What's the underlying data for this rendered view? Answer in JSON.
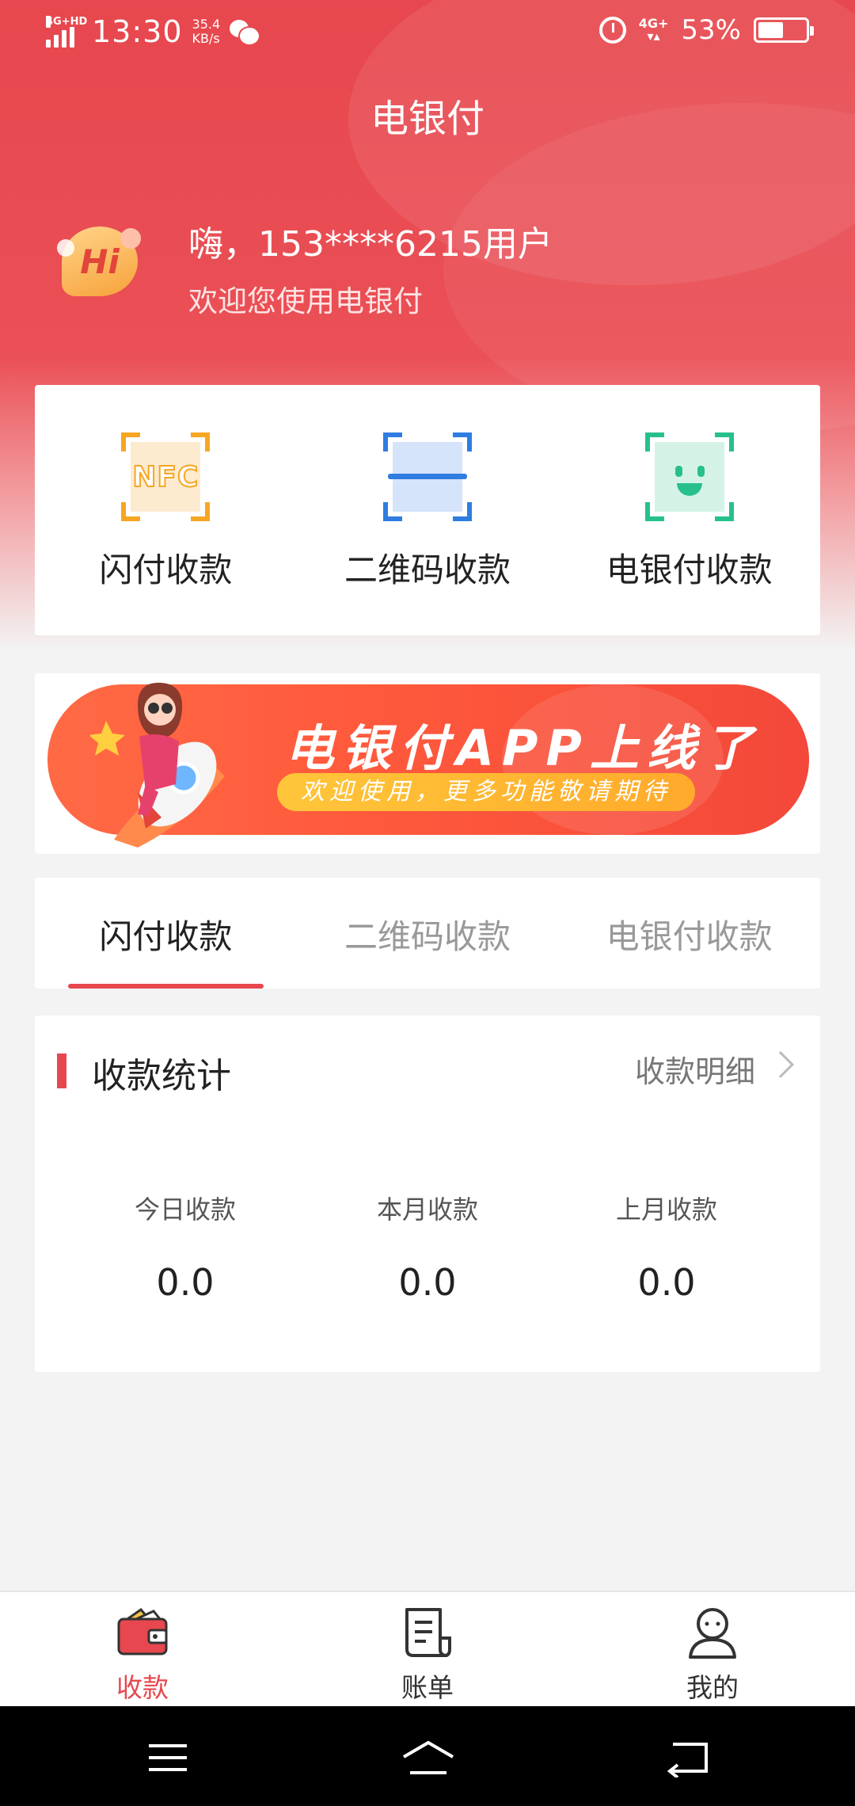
{
  "status_bar": {
    "network_label": "4G+HD",
    "time": "13:30",
    "speed_value": "35.4",
    "speed_unit": "KB/s",
    "network_right": "4G+",
    "battery_pct": "53%",
    "battery_level": 0.53
  },
  "header": {
    "title": "电银付"
  },
  "greeting": {
    "avatar_text": "Hi",
    "name": "嗨，153****6215用户",
    "subtitle": "欢迎您使用电银付"
  },
  "quick_actions": [
    {
      "label": "闪付收款",
      "icon": "nfc-icon",
      "icon_text": "NFC",
      "color": "#f6a623"
    },
    {
      "label": "二维码收款",
      "icon": "qr-scan-icon",
      "color": "#2f7de1"
    },
    {
      "label": "电银付收款",
      "icon": "face-scan-icon",
      "color": "#27c08d"
    }
  ],
  "banner": {
    "title": "电银付APP上线了",
    "subtitle": "欢迎使用，更多功能敬请期待"
  },
  "tabs": [
    {
      "label": "闪付收款",
      "active": true
    },
    {
      "label": "二维码收款",
      "active": false
    },
    {
      "label": "电银付收款",
      "active": false
    }
  ],
  "stats": {
    "title": "收款统计",
    "detail_link": "收款明细",
    "items": [
      {
        "label": "今日收款",
        "value": "0.0"
      },
      {
        "label": "本月收款",
        "value": "0.0"
      },
      {
        "label": "上月收款",
        "value": "0.0"
      }
    ]
  },
  "bottom_nav": [
    {
      "label": "收款",
      "icon": "wallet-icon",
      "active": true
    },
    {
      "label": "账单",
      "icon": "bill-icon",
      "active": false
    },
    {
      "label": "我的",
      "icon": "user-icon",
      "active": false
    }
  ],
  "colors": {
    "primary": "#e7474e",
    "nfc": "#f6a623",
    "qr": "#2f7de1",
    "face": "#27c08d"
  }
}
